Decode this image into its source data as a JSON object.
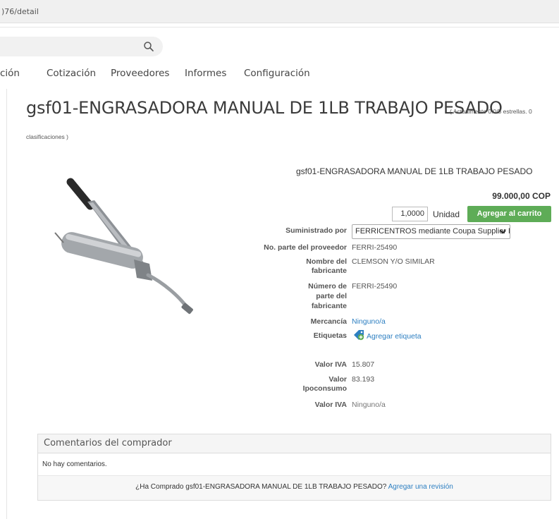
{
  "browser": {
    "url_fragment": ")76/detail"
  },
  "nav": {
    "tabs": [
      {
        "label": "ción"
      },
      {
        "label": "Cotización"
      },
      {
        "label": "Proveedores"
      },
      {
        "label": "Informes"
      },
      {
        "label": "Configuración"
      }
    ]
  },
  "product": {
    "title": "gsf01-ENGRASADORA MANUAL DE 1LB TRABAJO PESADO",
    "rating_line1": "( Actualmente 0.0/5 estrellas. 0",
    "rating_line2": "clasificaciones )",
    "rating_value": 0.0,
    "rating_max": 5,
    "name": "gsf01-ENGRASADORA MANUAL DE 1LB TRABAJO PESADO",
    "price": "99.000,00 COP",
    "quantity": "1,0000",
    "unit": "Unidad",
    "add_to_cart_label": "Agregar al carrito"
  },
  "details": {
    "supplied_by_label": "Suministrado por",
    "supplied_by_value": "FERRICENTROS mediante Coupa Supplier Portal",
    "supplier_part_label": "No. parte del proveedor",
    "supplier_part_value": "FERRI-25490",
    "manufacturer_name_label_1": "Nombre del",
    "manufacturer_name_label_2": "fabricante",
    "manufacturer_name_value": "CLEMSON Y/O SIMILAR",
    "manufacturer_part_label_1": "Número de",
    "manufacturer_part_label_2": "parte del",
    "manufacturer_part_label_3": "fabricante",
    "manufacturer_part_value": "FERRI-25490",
    "commodity_label": "Mercancía",
    "commodity_value": "Ninguno/a",
    "tags_label": "Etiquetas",
    "tags_add_label": "Agregar etiqueta",
    "iva_label": "Valor IVA",
    "iva_value": "15.807",
    "ipoconsumo_label_1": "Valor",
    "ipoconsumo_label_2": "Ipoconsumo",
    "ipoconsumo_value": "83.193",
    "iva2_label": "Valor IVA",
    "iva2_value": "Ninguno/a"
  },
  "comments": {
    "header": "Comentarios del comprador",
    "empty": "No hay comentarios.",
    "prompt": "¿Ha Comprado gsf01-ENGRASADORA MANUAL DE 1LB TRABAJO PESADO?",
    "review_link": "Agregar una revisión"
  },
  "colors": {
    "accent_green": "#5eac57",
    "link_blue": "#2d7fc1"
  },
  "icons": [
    "search-icon",
    "chevron-down-icon",
    "tag-add-icon"
  ]
}
